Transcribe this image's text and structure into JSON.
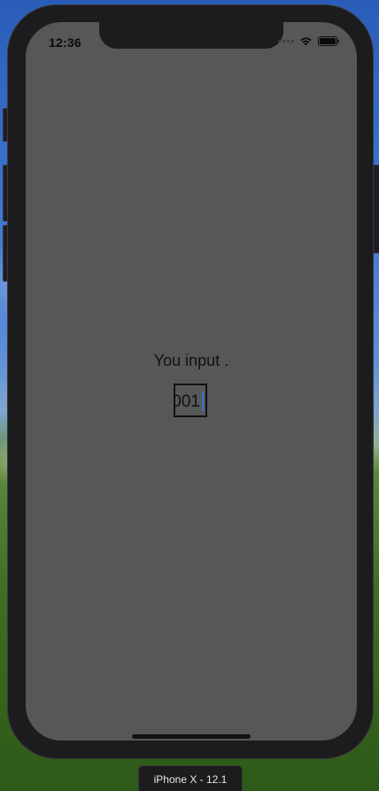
{
  "status_bar": {
    "time": "12:36",
    "icons": [
      "signal-icon",
      "wifi-icon",
      "battery-icon"
    ]
  },
  "content": {
    "prompt": "You input .",
    "input_value": "001"
  },
  "simulator": {
    "device_label": "iPhone X - 12.1"
  },
  "colors": {
    "screen_background": "#575757",
    "text": "#111111",
    "caret": "#3b6fd8",
    "device_frame": "#1c1c1e"
  }
}
